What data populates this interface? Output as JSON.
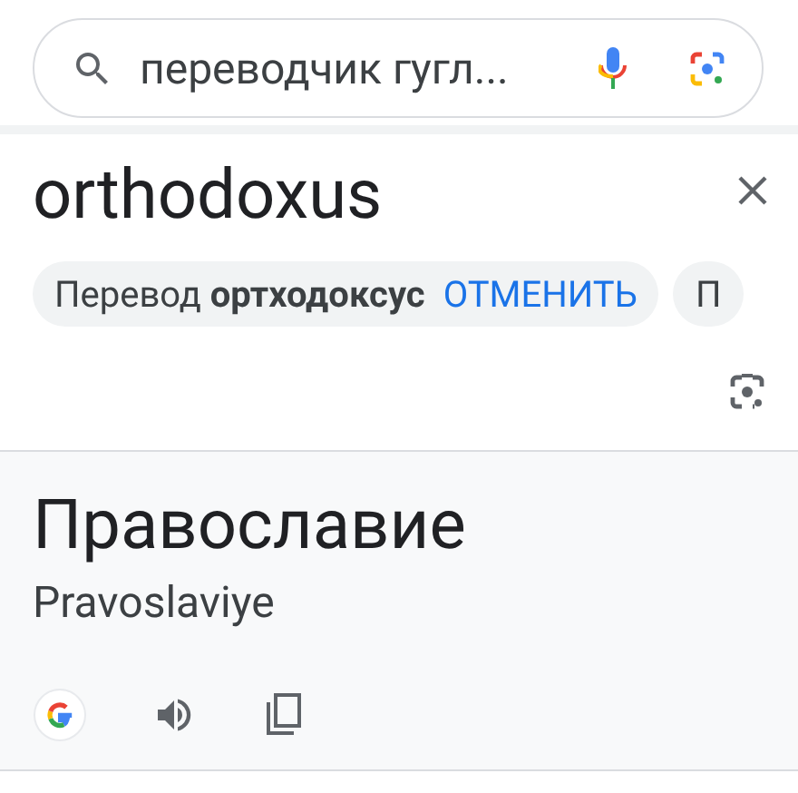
{
  "search": {
    "value": "переводчик гугл..."
  },
  "source": {
    "text": "orthodoxus"
  },
  "chips": [
    {
      "kind": "correction",
      "text": "Перевод **ортходоксус**",
      "action": "ОТМЕНИТЬ"
    },
    {
      "kind": "plain",
      "text": "П"
    }
  ],
  "result": {
    "translation": "Православие",
    "transliteration": "Pravoslaviye"
  }
}
